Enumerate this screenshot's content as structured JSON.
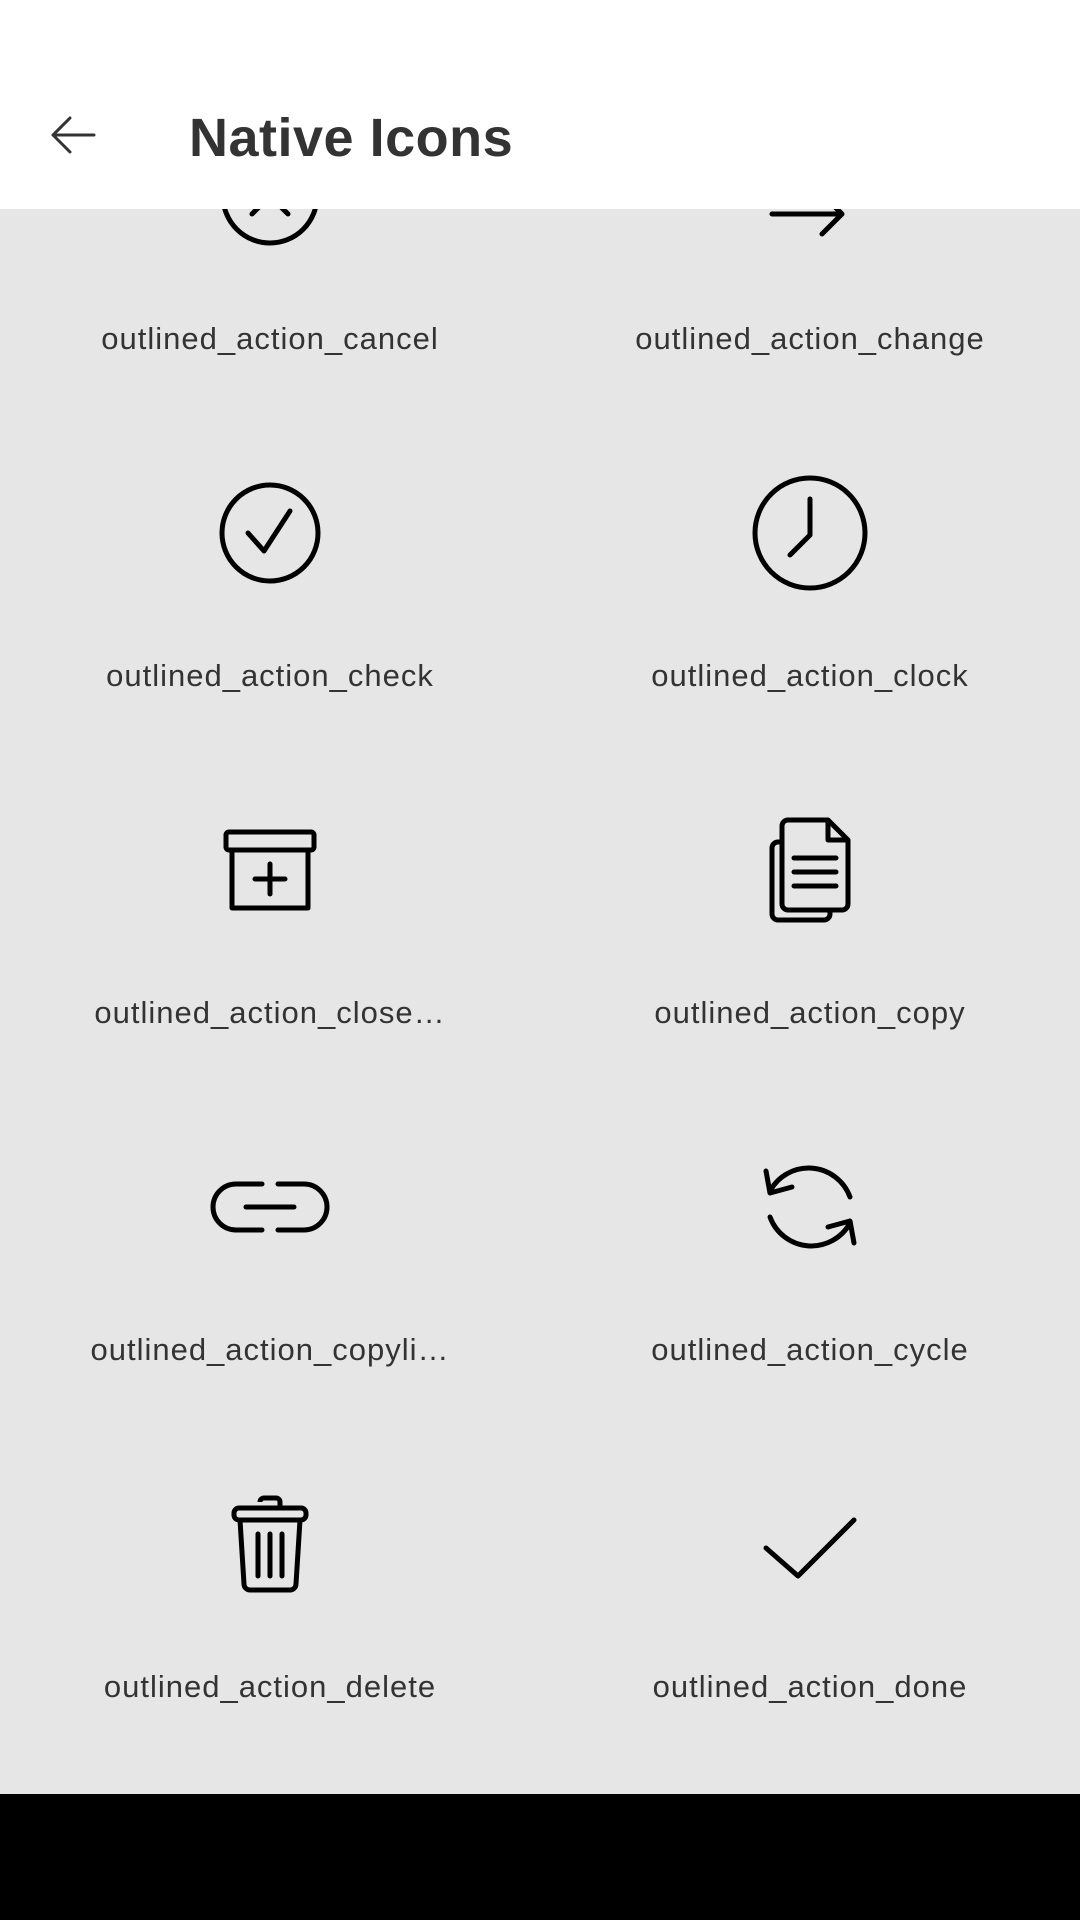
{
  "header": {
    "title": "Native Icons",
    "back_icon": "arrow-left-icon"
  },
  "icons": [
    {
      "label": "outlined_action_cancel",
      "icon": "cancel-icon"
    },
    {
      "label": "outlined_action_change",
      "icon": "change-icon"
    },
    {
      "label": "outlined_action_check",
      "icon": "check-circle-icon"
    },
    {
      "label": "outlined_action_clock",
      "icon": "clock-icon"
    },
    {
      "label": "outlined_action_close…",
      "icon": "archive-box-icon"
    },
    {
      "label": "outlined_action_copy",
      "icon": "copy-icon"
    },
    {
      "label": "outlined_action_copyli…",
      "icon": "link-icon"
    },
    {
      "label": "outlined_action_cycle",
      "icon": "cycle-icon"
    },
    {
      "label": "outlined_action_delete",
      "icon": "trash-icon"
    },
    {
      "label": "outlined_action_done",
      "icon": "done-icon"
    }
  ],
  "colors": {
    "header_bg": "#ffffff",
    "content_bg": "#e6e6e6",
    "text": "#333333",
    "icon": "#000000",
    "nav_bar": "#000000"
  }
}
